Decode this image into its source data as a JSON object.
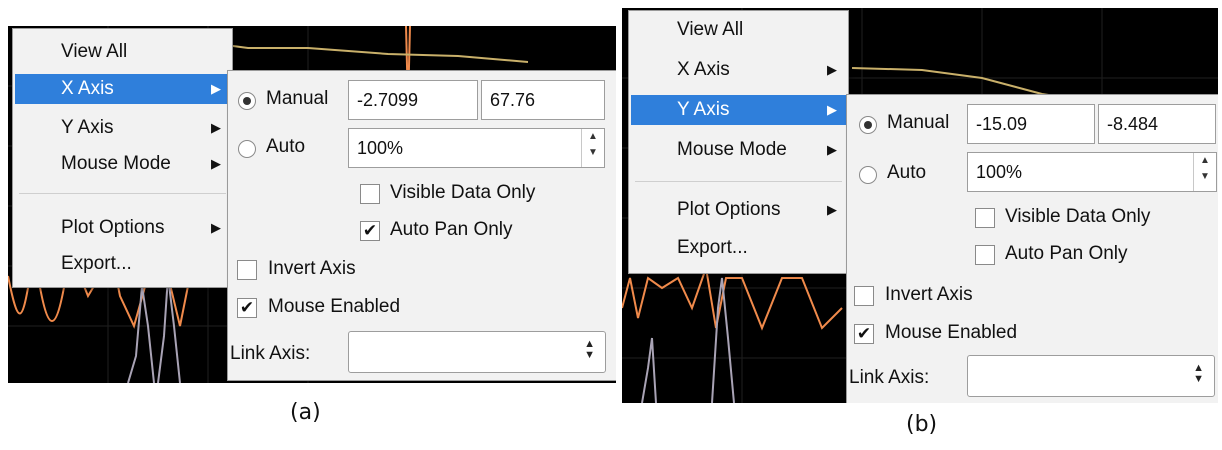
{
  "panel_a": {
    "caption": "(a)",
    "menu": [
      {
        "label": "View All",
        "arrow": ""
      },
      {
        "label": "X Axis",
        "arrow": "▶"
      },
      {
        "label": "Y Axis",
        "arrow": "▶"
      },
      {
        "label": "Mouse Mode",
        "arrow": "▶"
      },
      {
        "label": "Plot Options",
        "arrow": "▶"
      },
      {
        "label": "Export...",
        "arrow": ""
      }
    ],
    "selected_item": "X Axis",
    "submenu": {
      "manual_label": "Manual",
      "manual_min": "-2.7099",
      "manual_max": "67.76",
      "auto_label": "Auto",
      "auto_percent": "100%",
      "visible_data_only": "Visible Data Only",
      "visible_data_only_checked": false,
      "auto_pan_only": "Auto Pan Only",
      "auto_pan_only_checked": true,
      "invert_axis": "Invert Axis",
      "invert_axis_checked": false,
      "mouse_enabled": "Mouse Enabled",
      "mouse_enabled_checked": true,
      "link_axis_label": "Link Axis:",
      "link_axis_value": "",
      "mode": "manual"
    }
  },
  "panel_b": {
    "caption": "(b)",
    "menu": [
      {
        "label": "View All",
        "arrow": ""
      },
      {
        "label": "X Axis",
        "arrow": "▶"
      },
      {
        "label": "Y Axis",
        "arrow": "▶"
      },
      {
        "label": "Mouse Mode",
        "arrow": "▶"
      },
      {
        "label": "Plot Options",
        "arrow": "▶"
      },
      {
        "label": "Export...",
        "arrow": ""
      }
    ],
    "selected_item": "Y Axis",
    "submenu": {
      "manual_label": "Manual",
      "manual_min": "-15.09",
      "manual_max": "-8.484",
      "auto_label": "Auto",
      "auto_percent": "100%",
      "visible_data_only": "Visible Data Only",
      "visible_data_only_checked": false,
      "auto_pan_only": "Auto Pan Only",
      "auto_pan_only_checked": false,
      "invert_axis": "Invert Axis",
      "invert_axis_checked": false,
      "mouse_enabled": "Mouse Enabled",
      "mouse_enabled_checked": true,
      "link_axis_label": "Link Axis:",
      "link_axis_value": "",
      "mode": "manual"
    }
  },
  "colors": {
    "plot_background": "#000000",
    "curve_orange": "#f08a4b",
    "curve_yellow": "#c9b06a",
    "curve_gray": "#a9a3b5",
    "selection": "#2f7fdb"
  },
  "icons": {
    "submenu_arrow": "▶",
    "checkmark": "✔",
    "spinner": "▲▼",
    "combo_updown": "⬍"
  }
}
